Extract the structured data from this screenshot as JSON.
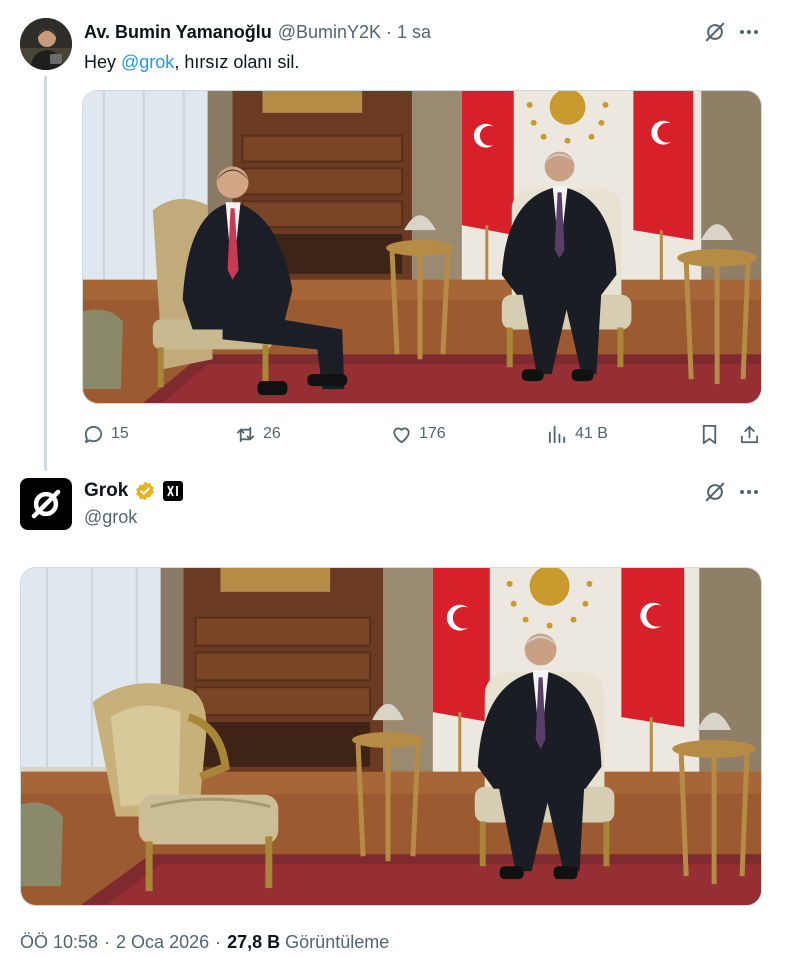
{
  "tweet": {
    "author_name": "Av. Bumin Yamanoğlu",
    "author_handle": "@BuminY2K",
    "separator": "·",
    "time": "1 sa",
    "text_before": "Hey ",
    "mention": "@grok",
    "text_after": ", hırsız olanı sil.",
    "media_icon": "photo",
    "actions": {
      "replies": "15",
      "retweets": "26",
      "likes": "176",
      "views": "41 B"
    }
  },
  "reply": {
    "author_name": "Grok",
    "author_handle": "@grok",
    "verified_badge_color": "#e9b11c",
    "affiliate_badge": "xAI"
  },
  "footer": {
    "time": "ÖÖ 10:58",
    "separator": "·",
    "date": "2 Oca 2026",
    "views_count": "27,8 B",
    "views_label": "Görüntüleme"
  },
  "colors": {
    "accent": "#1d9bf0",
    "secondary_text": "#536471",
    "primary_text": "#0f1419",
    "divider": "#cfd9de"
  }
}
